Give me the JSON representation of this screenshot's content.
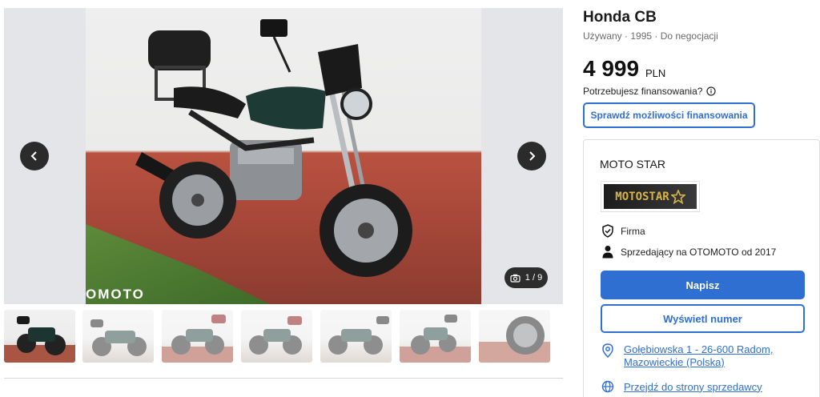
{
  "listing": {
    "title": "Honda CB",
    "meta": "Używany · 1995 · Do negocjacji",
    "price": "4 999",
    "currency": "PLN",
    "financing_question": "Potrzebujesz finansowania?",
    "financing_button": "Sprawdź możliwości finansowania"
  },
  "gallery": {
    "counter": "1 / 9",
    "watermark": "OMOTO",
    "thumbnails": [
      {
        "label": "photo 1"
      },
      {
        "label": "photo 2"
      },
      {
        "label": "photo 3"
      },
      {
        "label": "photo 4"
      },
      {
        "label": "photo 5"
      },
      {
        "label": "photo 6"
      },
      {
        "label": "photo 7"
      }
    ]
  },
  "seller": {
    "name": "MOTO STAR",
    "logo_text": "MOTOSTAR",
    "type": "Firma",
    "since": "Sprzedający na OTOMOTO od 2017",
    "write_button": "Napisz",
    "show_number_button": "Wyświetl numer",
    "address": "Gołębiowska 1 - 26-600 Radom, Mazowieckie (Polska)",
    "website_link": "Przejdź do strony sprzedawcy"
  },
  "colors": {
    "accent": "#2f6fd1",
    "dark_button": "#2b2b2b",
    "logo_gold": "#d8b24a"
  }
}
